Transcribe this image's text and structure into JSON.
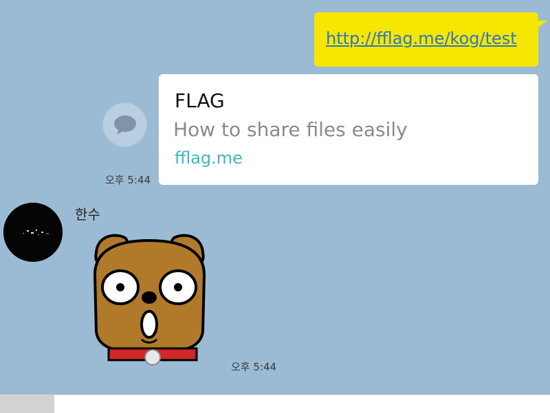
{
  "outgoing": {
    "link": "http://fflag.me/kog/test",
    "bubble_color": "#f7e600",
    "link_color": "#2a78c8"
  },
  "link_preview": {
    "title": "FLAG",
    "description": "How to share files easily",
    "domain": "fflag.me",
    "domain_color": "#3fb6c4"
  },
  "share_button": {
    "icon": "chat-bubble-icon"
  },
  "timestamps": {
    "outgoing": "오후 5:44",
    "incoming": "오후 5:44"
  },
  "incoming": {
    "sender_name": "한수",
    "sticker": "dog-sticker"
  },
  "colors": {
    "chat_background": "#9bbbd4"
  }
}
